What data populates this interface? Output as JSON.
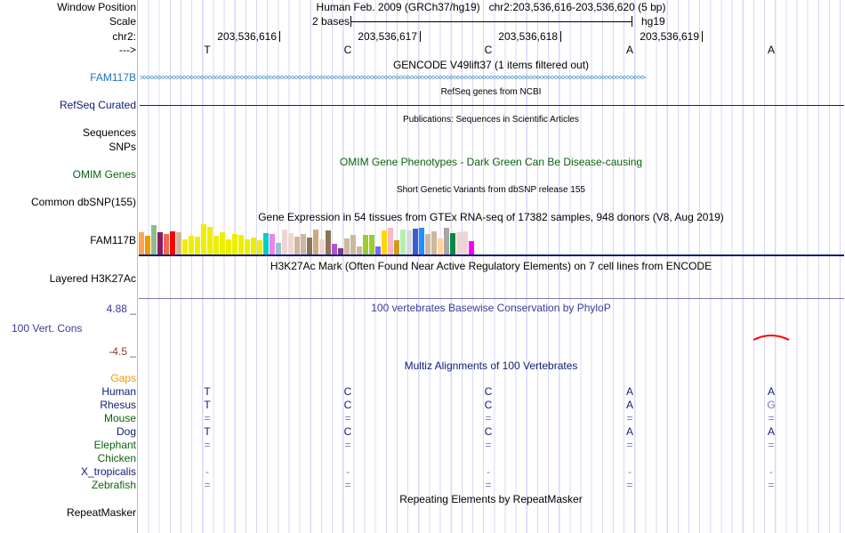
{
  "header": {
    "window_position_label": "Window Position",
    "window_position": "Human Feb. 2009 (GRCh37/hg19)   chr2:203,536,616-203,536,620 (5 bp)",
    "scale_label": "Scale",
    "scale_text": "2 bases",
    "assembly": "hg19",
    "chrom_label": "chr2:",
    "strand_label": "--->",
    "positions": [
      "203,536,616",
      "203,536,617",
      "203,536,618",
      "203,536,619"
    ],
    "bases": [
      "T",
      "C",
      "C",
      "A",
      "A"
    ]
  },
  "tracks": {
    "gencode": {
      "title": "GENCODE V49lift37 (1 items filtered out)",
      "label": "FAM117B",
      "color": "#1f74b8"
    },
    "refseq": {
      "title": "RefSeq genes from NCBI",
      "label": "RefSeq Curated"
    },
    "pubs": {
      "title": "Publications: Sequences in Scientific Articles",
      "label1": "Sequences",
      "label2": "SNPs"
    },
    "omim": {
      "title": "OMIM Gene Phenotypes - Dark Green Can Be Disease-causing",
      "label": "OMIM Genes"
    },
    "dbsnp": {
      "title": "Short Genetic Variants from dbSNP release 155",
      "label": "Common dbSNP(155)"
    },
    "gtex": {
      "title": "Gene Expression in 54 tissues from GTEx RNA-seq of 17382 samples, 948 donors (V8, Aug 2019)",
      "label": "FAM117B",
      "values": [
        25,
        21,
        33,
        25,
        23,
        26,
        25,
        17,
        21,
        20,
        34,
        31,
        21,
        25,
        17,
        23,
        22,
        17,
        19,
        16,
        24,
        23,
        13,
        28,
        24,
        20,
        23,
        19,
        28,
        17,
        27,
        12,
        7,
        18,
        22,
        9,
        22,
        22,
        9,
        27,
        30,
        16,
        28,
        27,
        29,
        30,
        23,
        26,
        18,
        30,
        24,
        25,
        26,
        15
      ],
      "colors": [
        "#ffa54f",
        "#ee9a00",
        "#8fbc8f",
        "#8b1c62",
        "#ee6a50",
        "#ff0000",
        "#cdb79e",
        "#eeee00",
        "#eeee00",
        "#eeee00",
        "#eeee00",
        "#eeee00",
        "#eeee00",
        "#eeee00",
        "#eeee00",
        "#eeee00",
        "#eeee00",
        "#eeee00",
        "#eeee00",
        "#eeee00",
        "#00cdcd",
        "#ee82ee",
        "#9ac0cd",
        "#eed5d2",
        "#eed5d2",
        "#cdb79e",
        "#cdb79e",
        "#8b7355",
        "#cdaa7d",
        "#eed5d2",
        "#8b7355",
        "#b452cd",
        "#7a378b",
        "#cdb79e",
        "#cdb79e",
        "#cdb79e",
        "#9acd32",
        "#9acd32",
        "#7b68ee",
        "#ffd700",
        "#ffb6c1",
        "#cd9b1d",
        "#b4eeb4",
        "#d9d9d9",
        "#3a5fcd",
        "#1e90ff",
        "#cdb79e",
        "#cdb79e",
        "#ffd39b",
        "#a6a6a6",
        "#008b45",
        "#eed5d2",
        "#eed5d2",
        "#ff00ff"
      ]
    },
    "h3k27ac": {
      "title": "H3K27Ac Mark (Often Found Near Active Regulatory Elements) on 7 cell lines from ENCODE",
      "label": "Layered H3K27Ac"
    },
    "cons": {
      "title": "100 vertebrates Basewise Conservation by PhyloP",
      "label": "100 Vert. Cons",
      "max": "4.88 _",
      "min": "-4.5 _"
    },
    "multiz": {
      "title": "Multiz Alignments of 100 Vertebrates",
      "gaps_label": "Gaps",
      "species": [
        {
          "name": "Human",
          "color": "#0d1d74",
          "bases": [
            "T",
            "C",
            "C",
            "A",
            "A"
          ]
        },
        {
          "name": "Rhesus",
          "color": "#0d1d74",
          "bases": [
            "T",
            "C",
            "C",
            "A",
            "G"
          ]
        },
        {
          "name": "Mouse",
          "color": "#0d620d",
          "bases": [
            "=",
            "=",
            "=",
            "=",
            "="
          ]
        },
        {
          "name": "Dog",
          "color": "#0d1d74",
          "bases": [
            "T",
            "C",
            "C",
            "A",
            "A"
          ]
        },
        {
          "name": "Elephant",
          "color": "#0d620d",
          "bases": [
            "=",
            "=",
            "=",
            "=",
            "="
          ]
        },
        {
          "name": "Chicken",
          "color": "#0d620d",
          "bases": [
            "",
            "",
            "",
            "",
            ""
          ]
        },
        {
          "name": "X_tropicalis",
          "color": "#0d1d74",
          "bases": [
            "-",
            "-",
            "-",
            "-",
            "-"
          ]
        },
        {
          "name": "Zebrafish",
          "color": "#0d620d",
          "bases": [
            "=",
            "=",
            "=",
            "=",
            "="
          ]
        }
      ]
    },
    "rmsk": {
      "title": "Repeating Elements by RepeatMasker",
      "label": "RepeatMasker"
    }
  }
}
